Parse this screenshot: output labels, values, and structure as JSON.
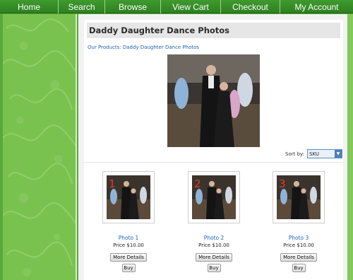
{
  "nav": {
    "items": [
      {
        "label": "Home"
      },
      {
        "label": "Search"
      },
      {
        "label": "Browse"
      },
      {
        "label": "View Cart"
      },
      {
        "label": "Checkout"
      },
      {
        "label": "My Account"
      }
    ]
  },
  "page": {
    "title": "Daddy Daughter Dance Photos",
    "breadcrumb": {
      "root": "Our Products",
      "separator": ":",
      "current": "Daddy Daughter Dance Photos"
    }
  },
  "sort": {
    "label": "Sort by:",
    "value": "SKU"
  },
  "products": [
    {
      "name": "Photo 1",
      "price": "Price $10.00",
      "details_label": "More Details",
      "buy_label": "Buy",
      "badge": "1"
    },
    {
      "name": "Photo 2",
      "price": "Price $10.00",
      "details_label": "More Details",
      "buy_label": "Buy",
      "badge": "2"
    },
    {
      "name": "Photo 3",
      "price": "Price $10.00",
      "details_label": "More Details",
      "buy_label": "Buy",
      "badge": "3"
    }
  ],
  "colors": {
    "nav_bg": "#3f9a2e",
    "accent_green": "#79c24f",
    "link": "#1e63b8",
    "badge": "#e23a2a"
  }
}
